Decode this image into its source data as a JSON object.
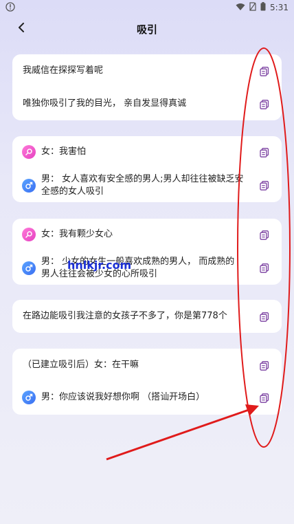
{
  "status": {
    "time": "5:31"
  },
  "header": {
    "title": "吸引"
  },
  "cards": [
    {
      "rows": [
        {
          "text": "我威信在探探写着呢"
        },
        {
          "text": "唯独你吸引了我的目光， 亲自发显得真诚"
        }
      ]
    },
    {
      "rows": [
        {
          "gender": "female",
          "text": "女：我害怕"
        },
        {
          "gender": "male",
          "line1": "男： 女人喜欢有安全感的男人;男人却往往被缺乏安",
          "line2": "全感的女人吸引"
        }
      ]
    },
    {
      "rows": [
        {
          "gender": "female",
          "text": "女：我有颗少女心"
        },
        {
          "gender": "male",
          "line1": "男： 少女的女生一般喜欢成熟的男人， 而成熟的",
          "line2": "男人往往会被少女的心所吸引"
        }
      ]
    },
    {
      "rows": [
        {
          "text": "在路边能吸引我注意的女孩子不多了，你是第778个"
        }
      ]
    },
    {
      "rows": [
        {
          "text": "（已建立吸引后）女：在干嘛"
        },
        {
          "gender": "male",
          "text": "男：你应该说我好想你啊 （搭讪开场白）"
        }
      ]
    }
  ],
  "watermark": "hnlkjr.com",
  "colors": {
    "annotation": "#e01b1b",
    "female_icon": "#e541c0",
    "male_icon": "#3b6ff2",
    "copy_icon": "#7a3fa0"
  },
  "icons": {
    "back": "chevron-left-icon",
    "copy": "copy-icon",
    "female": "female-symbol-icon",
    "male": "male-symbol-icon"
  }
}
